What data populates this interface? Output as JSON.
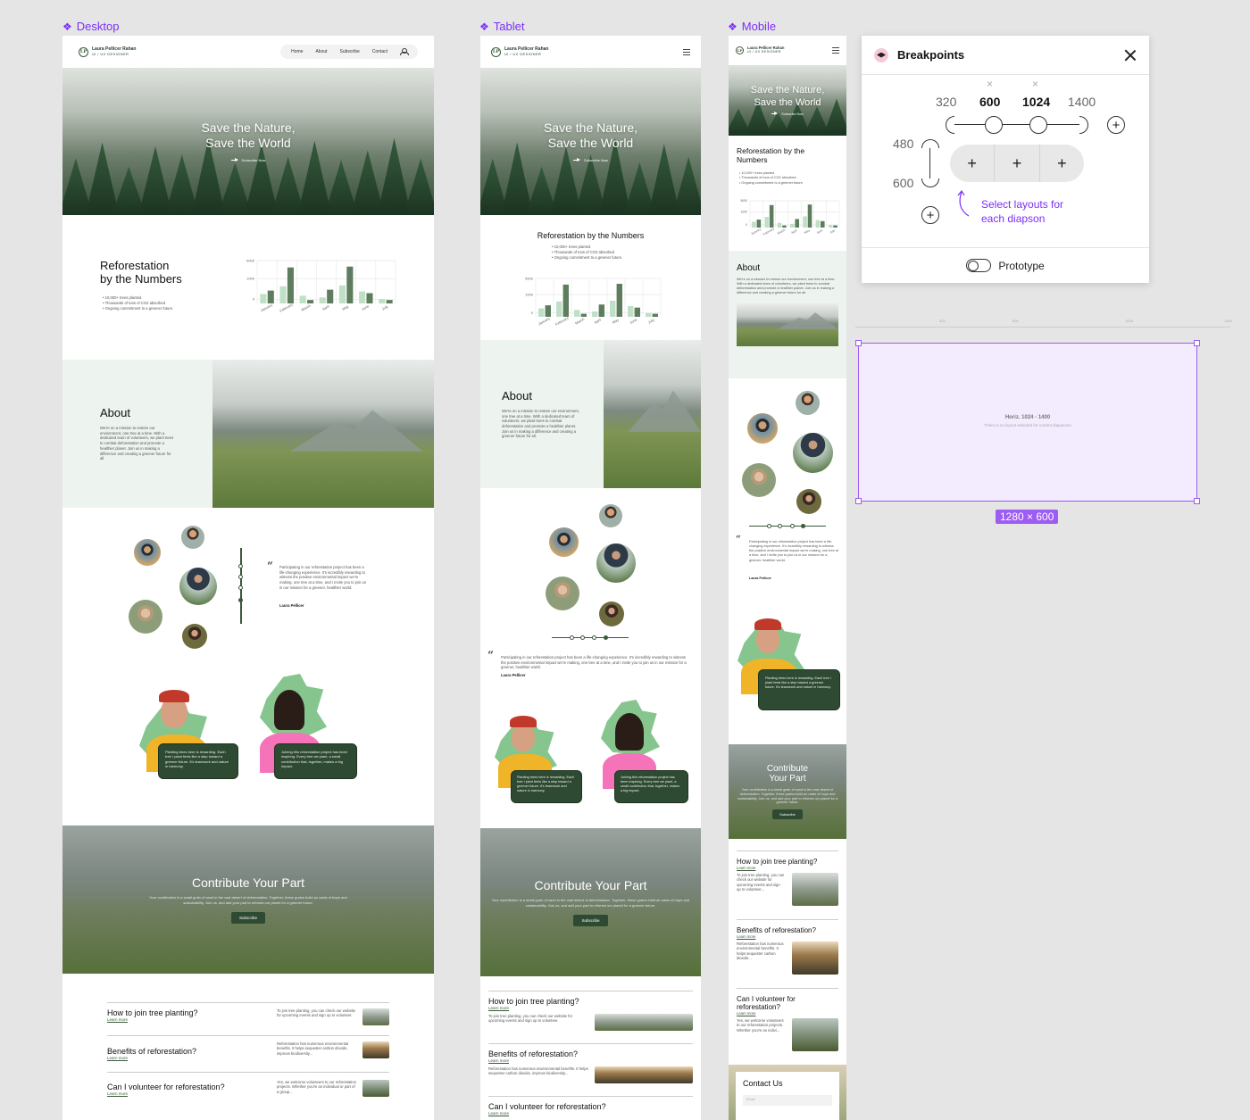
{
  "frames": {
    "desktop_label": "Desktop",
    "tablet_label": "Tablet",
    "mobile_label": "Mobile"
  },
  "brand": {
    "name": "Laura Pellicer Rahan",
    "role": "UI / UX DESIGNER",
    "mark": "LP"
  },
  "nav": {
    "items": [
      "Home",
      "About",
      "Subscribe",
      "Contact"
    ]
  },
  "hero": {
    "line1": "Save the Nature,",
    "line2": "Save the World",
    "cta": "Subscribe Now"
  },
  "stats": {
    "title_line1": "Reforestation",
    "title_line2": "by the Numbers",
    "title_full": "Reforestation by the Numbers",
    "mobile_title_line1": "Reforestation by the",
    "mobile_title_line2": "Numbers",
    "bullets": [
      "10,000+ trees planted",
      "Thousands of tons of CO2 absorbed",
      "Ongoing commitment to a greener future."
    ]
  },
  "chart_data": {
    "type": "bar",
    "categories": [
      "January",
      "February",
      "March",
      "April",
      "May",
      "June",
      "July"
    ],
    "y_ticks": [
      "5000",
      "1000",
      "0"
    ],
    "series": [
      {
        "values": [
          1100,
          2000,
          900,
          700,
          2100,
          1400,
          500
        ]
      },
      {
        "values": [
          1500,
          4200,
          400,
          1600,
          4300,
          1200,
          400
        ]
      }
    ],
    "colors": [
      "#bfe0c6",
      "#5e7d5e"
    ],
    "grid": true
  },
  "about": {
    "title": "About",
    "text": "We're on a mission to restore our environment, one tree at a time. With a dedicated team of volunteers, we plant trees to combat deforestation and promote a healthier planet. Join us in making a difference and creating a greener future for all."
  },
  "testimonial": {
    "quote_mark": "“",
    "text": "Participating in our reforestation project has been a life-changing experience. It's incredibly rewarding to witness the positive environmental impact we're making, one tree at a time, and I invite you to join us in our mission for a greener, healthier world.",
    "author": "Laura Pellicer"
  },
  "people": {
    "card1": "Planting trees here is rewarding. Each tree I plant feels like a step toward a greener future. It's teamwork and nature in harmony.",
    "card2": "Joining this reforestation project has been inspiring. Every tree we plant, a small contribution that, together, makes a big impact."
  },
  "contribute": {
    "title": "Contribute Your Part",
    "mobile_line1": "Contribute",
    "mobile_line2": "Your Part",
    "text": "Your contribution is a small grain of sand in the vast desert of deforestation. Together, these grains build an oasis of hope and sustainability. Join us, and add your part to reforest our planet for a greener future.",
    "button": "Subscribe"
  },
  "faq": {
    "learn_more": "Learn more",
    "desktop": [
      {
        "q": "How to join tree planting?",
        "a": "To join tree planting, you can check our website for upcoming events and sign up to volunteer."
      },
      {
        "q": "Benefits of reforestation?",
        "a": "Reforestation has numerous environmental benefits. It helps sequester carbon dioxide, improve biodiversity..."
      },
      {
        "q": "Can I volunteer for reforestation?",
        "a": "Yes, we welcome volunteers to our reforestation projects. Whether you're an individual or part of a group..."
      }
    ],
    "tablet": [
      {
        "q": "How to join tree planting?",
        "a": "To join tree planting, you can check our website for upcoming events and sign up to volunteer."
      },
      {
        "q": "Benefits of reforestation?",
        "a": "Reforestation has numerous environmental benefits. It helps sequester carbon dioxide, improve biodiversity..."
      },
      {
        "q": "Can I volunteer for reforestation?",
        "a": ""
      }
    ],
    "mobile": [
      {
        "q": "How to join tree planting?",
        "a": "To join tree planting, you can check our website for upcoming events and sign up to volunteer..."
      },
      {
        "q": "Benefits of reforestation?",
        "a": "Reforestation has numerous environmental benefits. It helps sequester carbon dioxide..."
      },
      {
        "q": "Can I volunteer for reforestation?",
        "a": "Yes, we welcome volunteers to our reforestation projects. Whether you're an indivi..."
      }
    ]
  },
  "contact": {
    "title": "Contact Us",
    "email_placeholder": "Email"
  },
  "breakpoints": {
    "title": "Breakpoints",
    "widths": [
      "320",
      "600",
      "1024",
      "1400"
    ],
    "heights": [
      "480",
      "600"
    ],
    "plus": "+",
    "remove": "×",
    "hint_line1": "Select layouts for",
    "hint_line2": "each diapson",
    "prototype_label": "Prototype"
  },
  "ruler": {
    "ticks": [
      "320",
      "600",
      "1024",
      "1400"
    ]
  },
  "selection": {
    "title": "Horiz. 1024 - 1400",
    "subtitle": "There is no layout selected for current diapasons",
    "size": "1280 × 600"
  },
  "colors": {
    "accent": "#7b2ff7",
    "brand_green": "#2f4a33",
    "bar_light": "#bfe0c6",
    "bar_dark": "#5e7d5e",
    "selection_fill": "#f3ebfe"
  }
}
